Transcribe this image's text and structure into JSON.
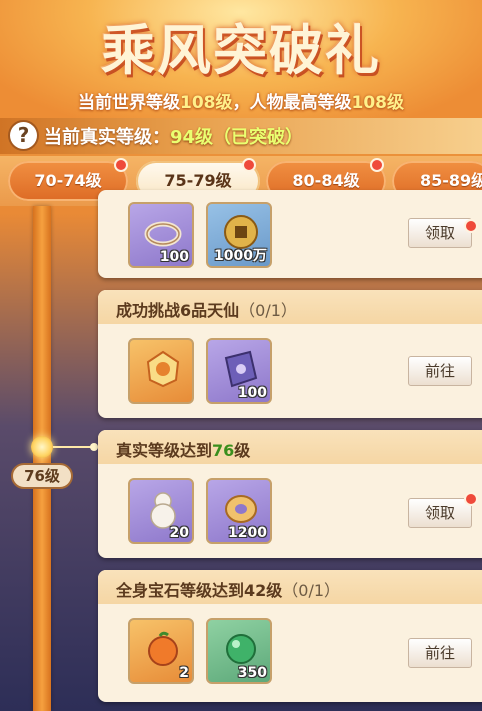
{
  "header": {
    "title": "乘风突破礼",
    "subtitle": {
      "prefix": "当前世界等级",
      "world_level": "108级",
      "mid": "，人物最高等级",
      "max_level": "108级"
    }
  },
  "real_level": {
    "help_icon": "?",
    "label": "当前真实等级：",
    "value": "94级（已突破）"
  },
  "tabs": [
    {
      "label": "70-74级",
      "active": false,
      "dot": false
    },
    {
      "label": "75-79级",
      "active": true,
      "dot": true
    },
    {
      "label": "80-84级",
      "active": false,
      "dot": true
    },
    {
      "label": "85-89级",
      "active": false,
      "dot": true
    }
  ],
  "timeline": {
    "node_level": "76级"
  },
  "tasks": [
    {
      "title": "",
      "items": [
        {
          "icon": "rope-icon",
          "count": "100",
          "color": "purple"
        },
        {
          "icon": "coin-icon",
          "count": "1000万",
          "color": "blue"
        }
      ],
      "button": "领取",
      "has_dot": true
    },
    {
      "title_prefix": "成功挑战6品天仙",
      "progress": "（0/1）",
      "items": [
        {
          "icon": "token-icon",
          "count": "",
          "color": "orange"
        },
        {
          "icon": "book-icon",
          "count": "100",
          "color": "purple"
        }
      ],
      "button": "前往",
      "has_dot": false
    },
    {
      "title_prefix": "真实等级达到",
      "title_level": "76",
      "title_suffix": "级",
      "items": [
        {
          "icon": "gourd-icon",
          "count": "20",
          "color": "purple"
        },
        {
          "icon": "jade-icon",
          "count": "1200",
          "color": "purple"
        }
      ],
      "button": "领取",
      "has_dot": true
    },
    {
      "title_prefix": "全身宝石等级达到42级",
      "progress": "（0/1）",
      "items": [
        {
          "icon": "fruit-icon",
          "count": "2",
          "color": "orange"
        },
        {
          "icon": "orb-icon",
          "count": "350",
          "color": "green"
        }
      ],
      "button": "前往",
      "has_dot": false
    }
  ],
  "colors": {
    "accent_green": "#3a8f1d",
    "real_value": "#eaff70",
    "tab_orange": "#dd6b25",
    "red_dot": "#ef4a3a"
  }
}
